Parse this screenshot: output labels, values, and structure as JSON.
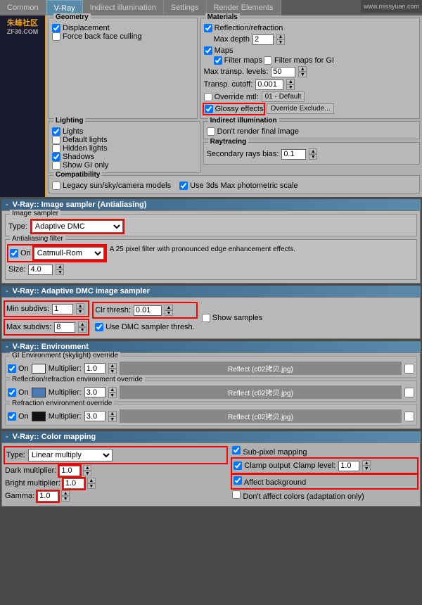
{
  "tabs": [
    {
      "label": "Common",
      "active": false
    },
    {
      "label": "V-Ray",
      "active": true
    },
    {
      "label": "Indirect illumination",
      "active": false
    },
    {
      "label": "Settings",
      "active": false
    },
    {
      "label": "Render Elements",
      "active": false
    }
  ],
  "watermark": "www.missyuan.com",
  "logo_line1": "朱峰社区",
  "logo_line2": "ZF30.COM",
  "geometry": {
    "title": "Geometry",
    "displacement": {
      "label": "Displacement",
      "checked": true
    },
    "force_back": {
      "label": "Force back face culling",
      "checked": false
    }
  },
  "materials": {
    "title": "Materials",
    "reflection": {
      "label": "Reflection/refraction",
      "checked": true
    },
    "max_depth": {
      "label": "Max depth",
      "value": "2"
    },
    "maps": {
      "label": "Maps",
      "checked": true
    },
    "filter_maps": {
      "label": "Filter maps",
      "checked": true
    },
    "filter_gi": {
      "label": "Filter maps for GI",
      "checked": false
    },
    "max_transp": {
      "label": "Max transp. levels:",
      "value": "50"
    },
    "transp_cutoff": {
      "label": "Transp. cutoff:",
      "value": "0.001"
    },
    "override_mtl": {
      "label": "Override mtl:",
      "checked": false,
      "value": "01 - Default"
    },
    "glossy": {
      "label": "Glossy effects",
      "checked": true
    },
    "override_exclude": "Override Exclude..."
  },
  "lighting": {
    "title": "Lighting",
    "lights": {
      "label": "Lights",
      "checked": true
    },
    "default_lights": {
      "label": "Default lights",
      "checked": false
    },
    "hidden_lights": {
      "label": "Hidden lights",
      "checked": false
    },
    "shadows": {
      "label": "Shadows",
      "checked": true
    },
    "show_gi_only": {
      "label": "Show GI only",
      "checked": false
    }
  },
  "indirect": {
    "title": "Indirect illumination",
    "dont_render": {
      "label": "Don't render final image",
      "checked": false
    }
  },
  "raytracing": {
    "title": "Raytracing",
    "secondary_bias": {
      "label": "Secondary rays bias:",
      "value": "0.1"
    }
  },
  "compatibility": {
    "title": "Compatibility",
    "legacy": {
      "label": "Legacy sun/sky/camera models",
      "checked": false
    },
    "photometric": {
      "label": "Use 3ds Max photometric scale",
      "checked": true
    }
  },
  "antialiasing": {
    "section_title": "V-Ray:: Image sampler (Antialiasing)",
    "image_sampler": "Image sampler",
    "type_label": "Type:",
    "type_value": "Adaptive DMC",
    "filter_title": "Antialiasing filter",
    "on_checked": true,
    "filter_value": "Catmull-Rom",
    "filter_desc": "A 25 pixel filter with pronounced edge enhancement effects.",
    "size_label": "Size:",
    "size_value": "4.0"
  },
  "adaptive_dmc": {
    "section_title": "V-Ray:: Adaptive DMC image sampler",
    "min_subdiv": {
      "label": "Min subdivs:",
      "value": "1"
    },
    "max_subdiv": {
      "label": "Max subdivs:",
      "value": "8"
    },
    "clr_thresh": {
      "label": "Clr thresh:",
      "value": "0.01"
    },
    "show_samples": {
      "label": "Show samples",
      "checked": false
    },
    "use_dmc": {
      "label": "Use DMC sampler thresh.",
      "checked": true
    }
  },
  "environment": {
    "section_title": "V-Ray:: Environment",
    "gi_override_title": "GI Environment (skylight) override",
    "on_gi": true,
    "mult_gi": "1.0",
    "reflect_gi": "Reflect (c02拷贝.jpg)",
    "refl_override_title": "Reflection/refraction environment override",
    "on_refl": true,
    "mult_refl": "3.0",
    "reflect_refl": "Reflect (c02拷贝.jpg)",
    "refr_override_title": "Refraction environment override",
    "on_refr": true,
    "mult_refr": "3.0",
    "reflect_refr": "Reflect (c02拷贝.jpg)"
  },
  "color_mapping": {
    "section_title": "V-Ray:: Color mapping",
    "type_label": "Type:",
    "type_value": "Linear multiply",
    "dark_mult": {
      "label": "Dark multiplier:",
      "value": "1.0"
    },
    "bright_mult": {
      "label": "Bright multiplier:",
      "value": "1.0"
    },
    "gamma": {
      "label": "Gamma:",
      "value": "1.0"
    },
    "sub_pixel": {
      "label": "Sub-pixel mapping",
      "checked": true
    },
    "clamp_output": {
      "label": "Clamp output",
      "checked": true
    },
    "clamp_level": {
      "label": "Clamp level:",
      "value": "1.0"
    },
    "affect_bg": {
      "label": "Affect background",
      "checked": true
    },
    "dont_affect": {
      "label": "Don't affect colors (adaptation only)",
      "checked": false
    }
  }
}
